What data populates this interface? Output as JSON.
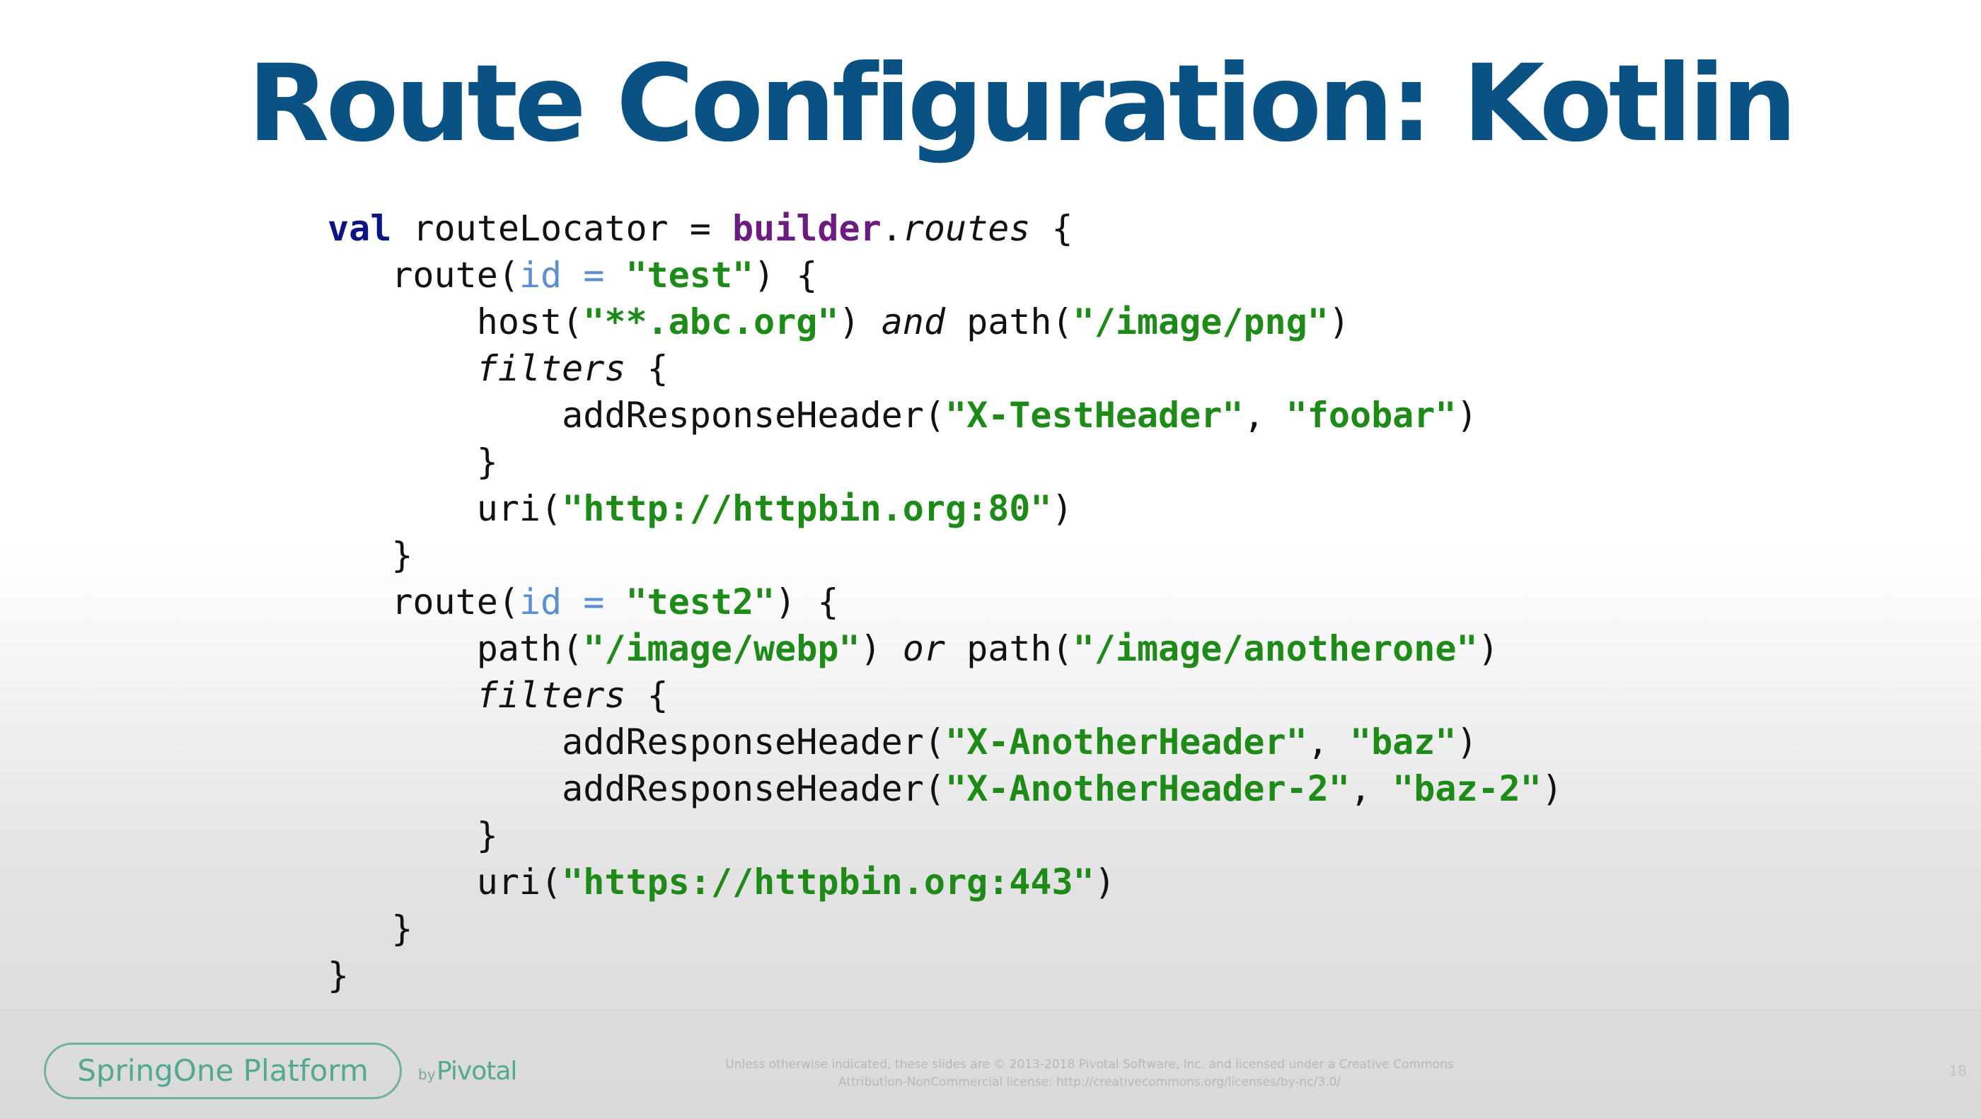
{
  "slide": {
    "title": "Route Configuration: Kotlin",
    "code": {
      "line1": {
        "val": "val",
        "route_locator": " routeLocator = ",
        "builder": "builder",
        "dot_routes": ".",
        "routes": "routes",
        "open": " {"
      },
      "line2": {
        "indent": "   ",
        "route": "route(",
        "param": "id = ",
        "string": "\"test\"",
        "close": ") {"
      },
      "line3": {
        "indent": "       ",
        "host": "host(",
        "host_string": "\"**.abc.org\"",
        "and_prefix": ") ",
        "and": "and",
        "path": " path(",
        "path_string": "\"/image/png\"",
        "close": ")"
      },
      "line4": {
        "indent": "       ",
        "filters": "filters",
        "open": " {"
      },
      "line5": {
        "indent": "           ",
        "call": "addResponseHeader(",
        "name": "\"X-TestHeader\"",
        "separator": ", ",
        "value": "\"foobar\"",
        "close": ")"
      },
      "line6": {
        "indent": "       ",
        "close": "}"
      },
      "line7": {
        "indent": "       ",
        "uri": "uri(",
        "string": "\"http://httpbin.org:80\"",
        "close": ")"
      },
      "line8": {
        "indent": "   ",
        "close": "}"
      },
      "line9": {
        "indent": "   ",
        "route": "route(",
        "param": "id = ",
        "string": "\"test2\"",
        "close": ") {"
      },
      "line10": {
        "indent": "       ",
        "path": "path(",
        "path_string": "\"/image/webp\"",
        "or_prefix": ") ",
        "or": "or",
        "path2": " path(",
        "path_string2": "\"/image/anotherone\"",
        "close": ")"
      },
      "line11": {
        "indent": "       ",
        "filters": "filters",
        "open": " {"
      },
      "line12": {
        "indent": "           ",
        "call": "addResponseHeader(",
        "name": "\"X-AnotherHeader\"",
        "separator": ", ",
        "value": "\"baz\"",
        "close": ")"
      },
      "line13": {
        "indent": "           ",
        "call": "addResponseHeader(",
        "name": "\"X-AnotherHeader-2\"",
        "separator": ", ",
        "value": "\"baz-2\"",
        "close": ")"
      },
      "line14": {
        "indent": "       ",
        "close": "}"
      },
      "line15": {
        "indent": "       ",
        "uri": "uri(",
        "string": "\"https://httpbin.org:443\"",
        "close": ")"
      },
      "line16": {
        "indent": "   ",
        "close": "}"
      },
      "line17": {
        "close": "}"
      }
    }
  },
  "footer": {
    "logo": "SpringOne Platform",
    "by": "by",
    "pivotal": "Pivotal",
    "legal_line1": "Unless otherwise indicated, these slides are © 2013-2018 Pivotal Software, Inc. and licensed under a Creative Commons",
    "legal_line2": "Attribution-NonCommercial license: http://creativecommons.org/licenses/by-nc/3.0/",
    "page_number": "18"
  },
  "colors": {
    "title": "#0a5284",
    "keyword": "#0b1580",
    "builder": "#6b1c7f",
    "string": "#1e8a18",
    "parameter": "#5b8fd0",
    "footer_green": "#52a890"
  },
  "icons": {
    "brand_logo": "springone-platform-logo"
  }
}
